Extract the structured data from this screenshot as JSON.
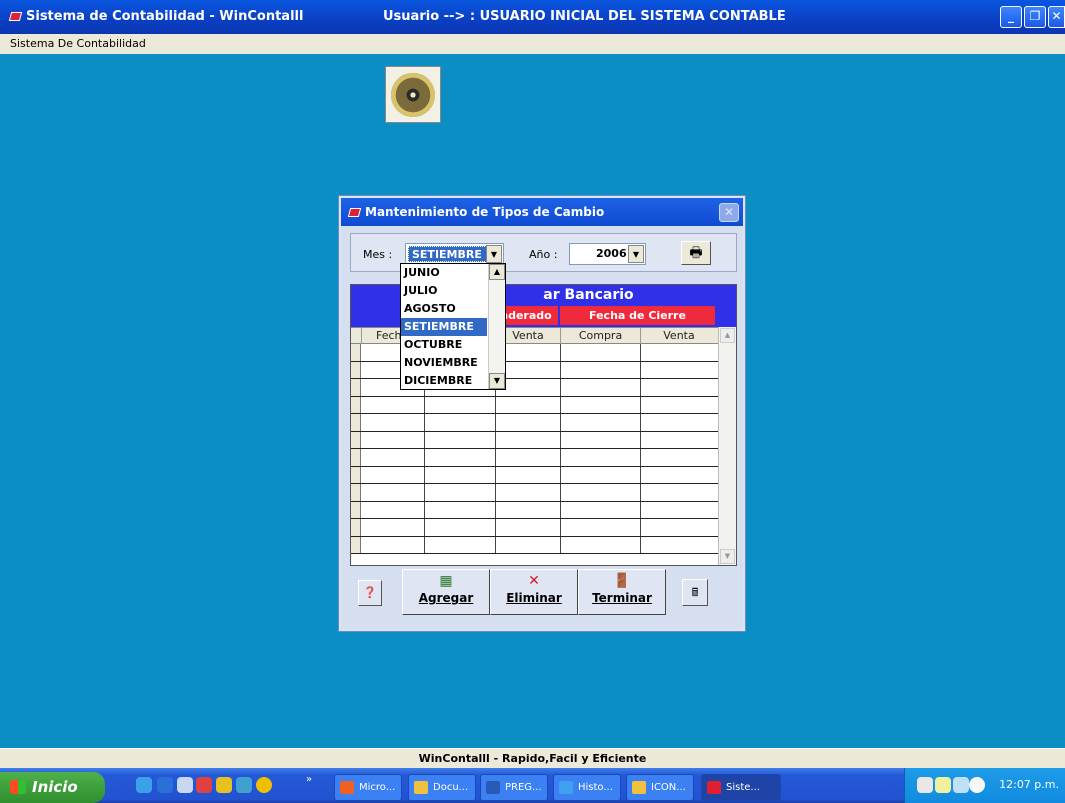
{
  "window": {
    "title": "Sistema de Contabilidad - WinContalll",
    "user_info": "Usuario --> : USUARIO  INICIAL  DEL  SISTEMA  CONTABLE",
    "menu_title": "Sistema De Contabilidad"
  },
  "dialog": {
    "title": "Mantenimiento de Tipos de Cambio",
    "mes_label": "Mes :",
    "mes_value": "SETIEMBRE",
    "anio_label": "Año :",
    "anio_value": "2006",
    "grid_title_partial": "ar Bancario",
    "header_ponderado_partial": "nderado",
    "header_fecha_cierre": "Fecha de Cierre",
    "columns": [
      "Fech",
      "Venta",
      "Compra",
      "Venta"
    ],
    "mes_options": [
      "JUNIO",
      "JULIO",
      "AGOSTO",
      "SETIEMBRE",
      "OCTUBRE",
      "NOVIEMBRE",
      "DICIEMBRE"
    ],
    "mes_selected_index": 3,
    "buttons": {
      "agregar": "Agregar",
      "eliminar": "Eliminar",
      "terminar": "Terminar"
    }
  },
  "statusbar": {
    "text": "WinContalll  - Rapido,Facil y Eficiente"
  },
  "taskbar": {
    "start_label": "Inicio",
    "tasks": [
      "Micro...",
      "Docu...",
      "PREG...",
      "Histo...",
      "ICON...",
      "Siste..."
    ],
    "clock": "12:07 p.m."
  }
}
